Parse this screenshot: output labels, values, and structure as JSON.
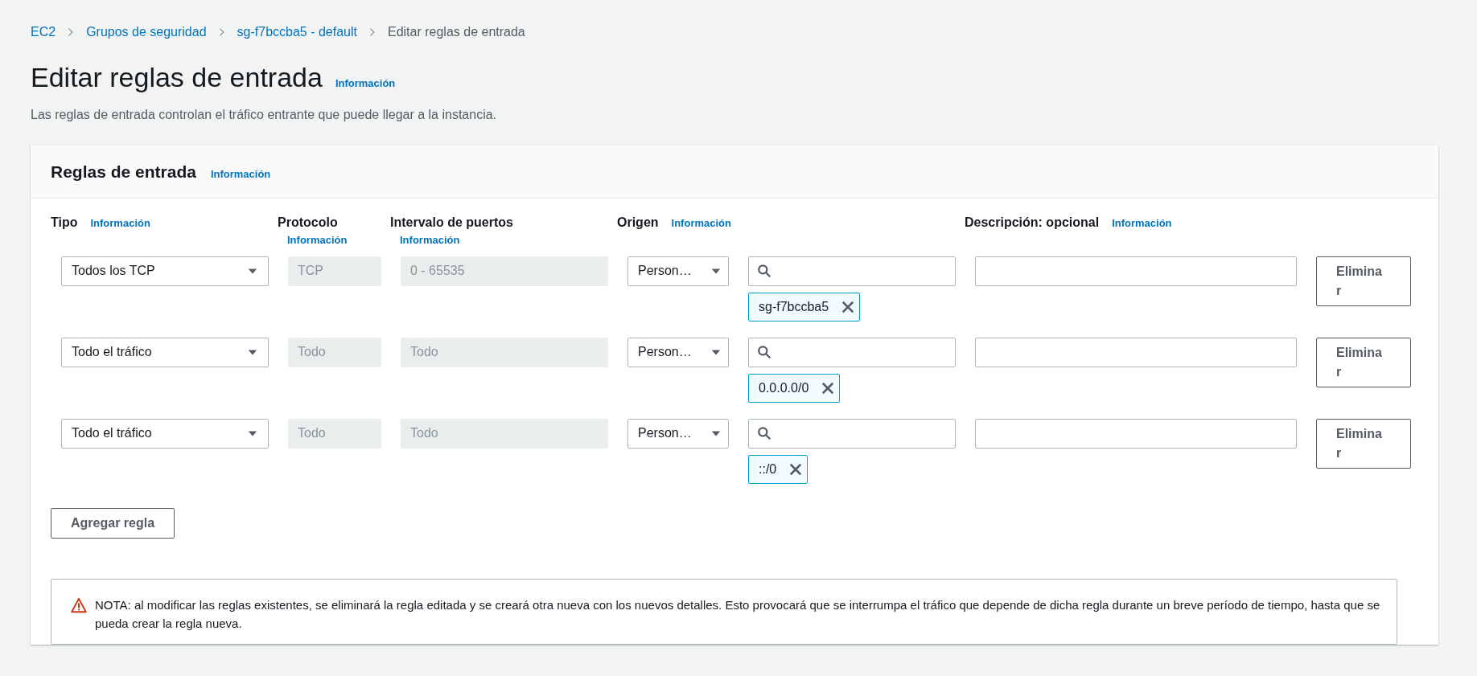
{
  "breadcrumbs": [
    {
      "label": "EC2",
      "current": false
    },
    {
      "label": "Grupos de seguridad",
      "current": false
    },
    {
      "label": "sg-f7bccba5 - default",
      "current": false
    },
    {
      "label": "Editar reglas de entrada",
      "current": true
    }
  ],
  "title": "Editar reglas de entrada",
  "title_info": "Información",
  "description": "Las reglas de entrada controlan el tráfico entrante que puede llegar a la instancia.",
  "panel": {
    "title": "Reglas de entrada",
    "info": "Información",
    "columns": [
      {
        "label": "Tipo",
        "info": "Información",
        "kind": "inline"
      },
      {
        "label": "Protocolo",
        "info": "Información",
        "kind": "stacked"
      },
      {
        "label": "Intervalo de puertos",
        "info": "Información",
        "kind": "stacked"
      },
      {
        "label": "Origen",
        "info": "Información",
        "kind": "inline"
      },
      {
        "label": "Descripción: opcional",
        "info": "Información",
        "kind": "inline"
      }
    ],
    "rules": [
      {
        "type": "Todos los TCP",
        "protocol": "TCP",
        "port_range": "0 - 65535",
        "source_type": "Person…",
        "source_tags": [
          "sg-f7bccba5"
        ],
        "delete_button": "Eliminar"
      },
      {
        "type": "Todo el tráfico",
        "protocol": "Todo",
        "port_range": "Todo",
        "source_type": "Person…",
        "source_tags": [
          "0.0.0.0/0"
        ],
        "delete_button": "Eliminar"
      },
      {
        "type": "Todo el tráfico",
        "protocol": "Todo",
        "port_range": "Todo",
        "source_type": "Person…",
        "source_tags": [
          "::/0"
        ],
        "delete_button": "Eliminar"
      }
    ],
    "add_button": "Agregar regla",
    "notice": "NOTA: al modificar las reglas existentes, se eliminará la regla editada y se creará otra nueva con los nuevos detalles. Esto provocará que se interrumpa el tráfico que depende de dicha regla durante un breve período de tiempo, hasta que se pueda crear la regla nueva."
  }
}
